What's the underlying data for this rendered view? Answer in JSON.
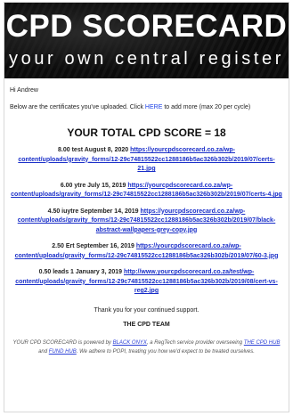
{
  "banner": {
    "title": "CPD SCORECARD",
    "subtitle": "your own central register"
  },
  "greeting": "Hi Andrew",
  "intro": {
    "before": "Below are the certificates you've uploaded. Click ",
    "link": "HERE",
    "after": " to add more (max 20 per cycle)"
  },
  "score_line": "YOUR TOTAL CPD SCORE = 18",
  "certificates": [
    {
      "label": "8.00 test August 8, 2020",
      "url": "https://yourcpdscorecard.co.za/wp-content/uploads/gravity_forms/12-29c74815522cc1288186b5ac326b302b/2019/07/certs-21.jpg"
    },
    {
      "label": "6.00 ytre July 15, 2019",
      "url": "https://yourcpdscorecard.co.za/wp-content/uploads/gravity_forms/12-29c74815522cc1288186b5ac326b302b/2019/07/certs-4.jpg"
    },
    {
      "label": "4.50 iuytre September 14, 2019",
      "url": "https://yourcpdscorecard.co.za/wp-content/uploads/gravity_forms/12-29c74815522cc1288186b5ac326b302b/2019/07/black-abstract-wallpapers-grey-copy.jpg"
    },
    {
      "label": "2.50 Ert September 16, 2019",
      "url": "https://yourcpdscorecard.co.za/wp-content/uploads/gravity_forms/12-29c74815522cc1288186b5ac326b302b/2019/07/60-3.jpg"
    },
    {
      "label": "0.50 leads 1 January 3, 2019",
      "url": "http://www.yourcpdscorecard.co.za/test/wp-content/uploads/gravity_forms/12-29c74815522cc1288186b5ac326b302b/2019/08/cert-vs-reg2.jpg"
    }
  ],
  "thanks": "Thank you for your continued support.",
  "team": "THE CPD TEAM",
  "footer": {
    "p1": "YOUR CPD SCORECARD is powered by ",
    "brand": "BLACK ONYX",
    "p2": ", a RegTech service provider overseeing ",
    "hub1": "THE CPD HUB",
    "p3": " and ",
    "hub2": "FUND HUB",
    "p4": ". We adhere to POPI, treating you how we'd expect to be treated ourselves."
  },
  "colors": {
    "link": "#1a2fc9",
    "banner_bg": "#0e0e0e",
    "footer_highlight": "#2b3fd6"
  }
}
